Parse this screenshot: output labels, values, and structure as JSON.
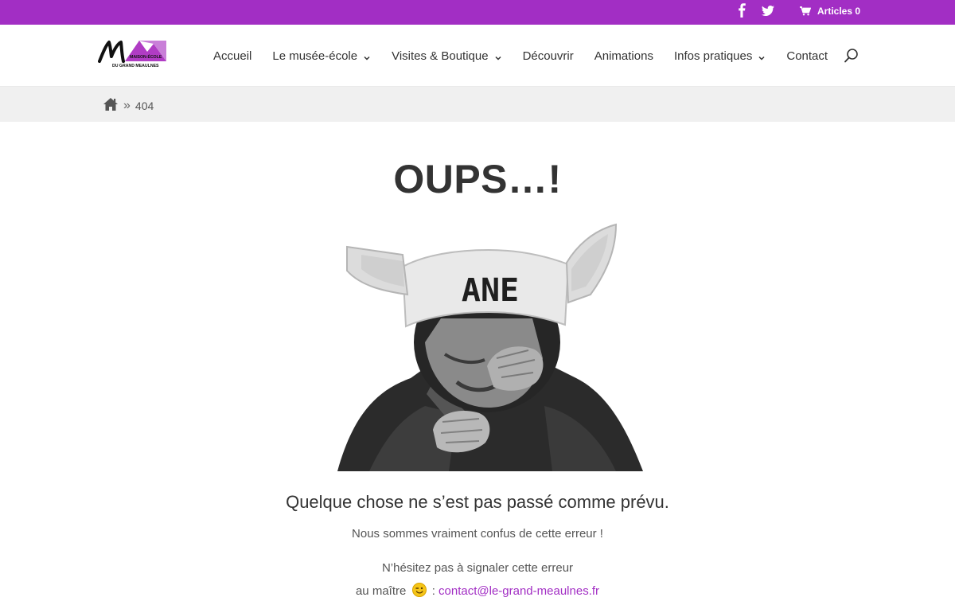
{
  "topbar": {
    "cart_label": "Articles 0",
    "social_icons": [
      "facebook-icon",
      "twitter-icon"
    ],
    "accent": "#a22ec4"
  },
  "header": {
    "logo_text_line1": "MAISON-ÉCOLE",
    "logo_text_line2": "DU GRAND MEAULNES",
    "nav": [
      {
        "label": "Accueil",
        "dropdown": false
      },
      {
        "label": "Le musée-école",
        "dropdown": true
      },
      {
        "label": "Visites & Boutique",
        "dropdown": true
      },
      {
        "label": "Découvrir",
        "dropdown": false
      },
      {
        "label": "Animations",
        "dropdown": false
      },
      {
        "label": "Infos pratiques",
        "dropdown": true
      },
      {
        "label": "Contact",
        "dropdown": false
      }
    ]
  },
  "breadcrumb": {
    "separator": "»",
    "current": "404"
  },
  "content": {
    "title": "OUPS…!",
    "hat_text": "ANE",
    "subtitle": "Quelque chose ne s’est pas passé comme prévu.",
    "line1": "Nous sommes vraiment confus de cette erreur !",
    "line2": "N’hésitez pas à signaler cette erreur",
    "line3_prefix": "au maître",
    "line3_colon": ":",
    "email": "contact@le-grand-meaulnes.fr"
  }
}
